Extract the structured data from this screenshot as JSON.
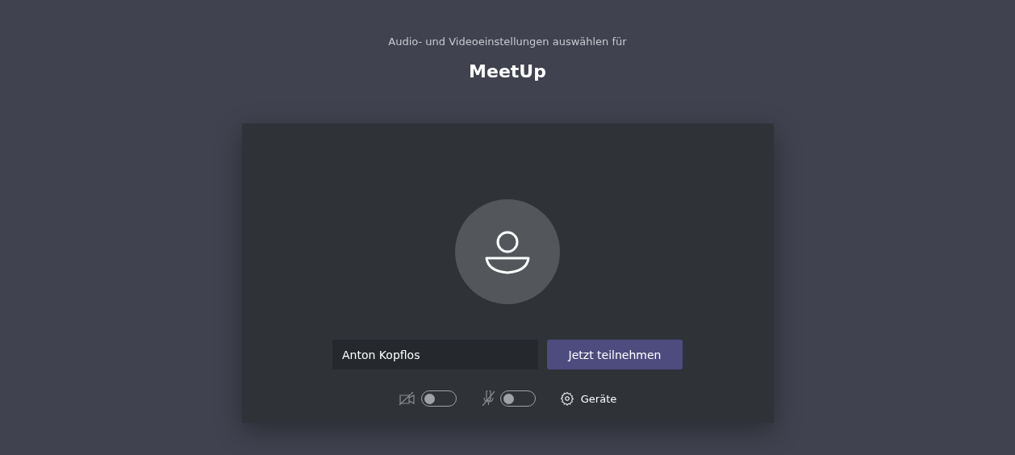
{
  "header": {
    "subtitle": "Audio- und Videoeinstellungen auswählen für",
    "title": "MeetUp"
  },
  "name_field": {
    "value": "Anton Kopflos"
  },
  "join_button": {
    "label": "Jetzt teilnehmen"
  },
  "toggles": [
    {
      "kind": "camera",
      "on": false
    },
    {
      "kind": "microphone",
      "on": false
    }
  ],
  "devices_button": {
    "label": "Geräte"
  }
}
